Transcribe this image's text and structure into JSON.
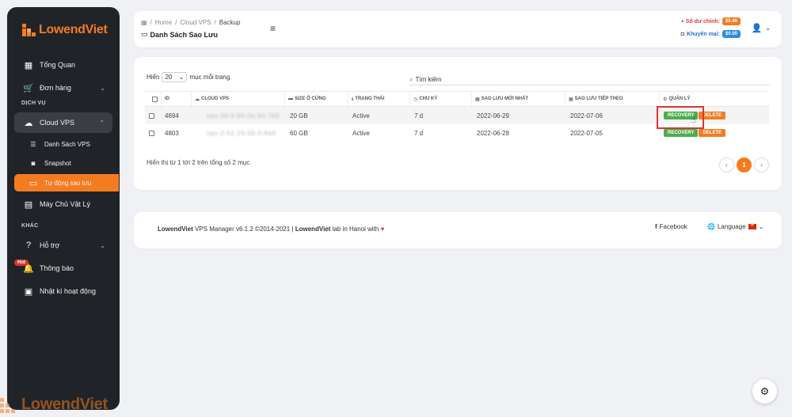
{
  "brand": {
    "name": "LowendViet",
    "accent": "#f47c20"
  },
  "sidebar": {
    "items": [
      {
        "label": "Tổng Quan",
        "icon": "dashboard-icon"
      },
      {
        "label": "Đơn hàng",
        "icon": "cart-icon"
      }
    ],
    "section_service": "DỊCH VỤ",
    "cloud_vps": {
      "label": "Cloud VPS",
      "icon": "cloud-icon"
    },
    "sub_items": [
      {
        "label": "Danh Sách VPS",
        "icon": "list-icon"
      },
      {
        "label": "Snapshot",
        "icon": "camera-icon"
      },
      {
        "label": "Tự động sao lưu",
        "icon": "backup-drive-icon",
        "active": true
      }
    ],
    "physical": {
      "label": "Máy Chủ Vật Lý",
      "icon": "server-icon"
    },
    "section_other": "KHÁC",
    "support": {
      "label": "Hỗ trợ",
      "icon": "help-icon"
    },
    "notifications": {
      "label": "Thông báo",
      "icon": "bell-icon",
      "badge": "Hot"
    },
    "activity": {
      "label": "Nhật kí hoạt động",
      "icon": "calendar-icon"
    }
  },
  "header": {
    "breadcrumb": [
      "Home",
      "Cloud VPS",
      "Backup"
    ],
    "title": "Danh Sách Sao Lưu",
    "balance_label": "Số dư chính:",
    "balance_value": "$0.46",
    "promo_label": "Khuyến mại:",
    "promo_value": "$0.00"
  },
  "table": {
    "length_prefix": "Hiển",
    "length_value": "20",
    "length_suffix": "mục mỗi trang",
    "search_label": "Tìm kiếm",
    "columns": {
      "id": "ID",
      "cloud": "CLOUD VPS",
      "size": "SIZE Ổ CỨNG",
      "status": "TRẠNG THÁI",
      "cycle": "CHU KỲ",
      "latest": "SAO LƯU MỚI NHẤT",
      "next": "SAO LƯU TIẾP THEO",
      "manage": "QUẢN LÝ"
    },
    "rows": [
      {
        "id": "4694",
        "cloud": "vps-3d-4-bh-3a-bh-7b6",
        "size": "20 GB",
        "status": "Active",
        "cycle": "7 d",
        "latest": "2022-06-29",
        "next": "2022-07-06"
      },
      {
        "id": "4803",
        "cloud": "vps-2-51-29-56-2-8e9",
        "size": "60 GB",
        "status": "Active",
        "cycle": "7 d",
        "latest": "2022-06-28",
        "next": "2022-07-05"
      }
    ],
    "recovery_label": "RECOVERY",
    "delete_label": "DELETE",
    "info": "Hiển thị từ 1 tới 2 trên tổng số 2 mục",
    "current_page": "1"
  },
  "footer": {
    "brand": "LowendViet",
    "version_text": " VPS Manager v6.1.2 ©2014-2021 | ",
    "lab_brand": "LowendViet",
    "lab_text": " lab in Hanoi with ",
    "facebook": "Facebook",
    "language": "Language"
  }
}
